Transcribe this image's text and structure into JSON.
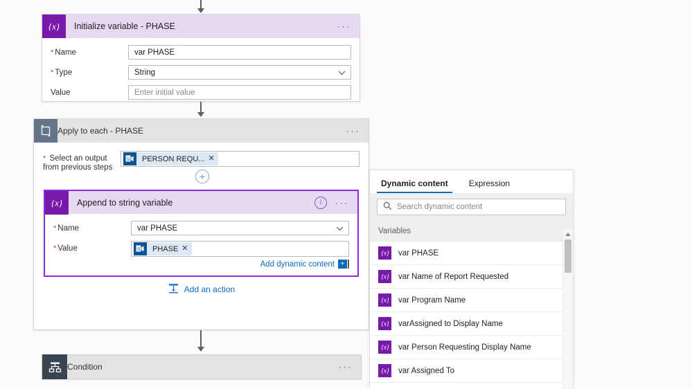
{
  "flow": {
    "initialize_variable": {
      "title": "Initialize variable - PHASE",
      "icon": "variable-icon",
      "fields": [
        {
          "label": "Name",
          "required": true,
          "value": "var PHASE",
          "is_placeholder": false,
          "control": "text"
        },
        {
          "label": "Type",
          "required": true,
          "value": "String",
          "is_placeholder": false,
          "control": "dropdown"
        },
        {
          "label": "Value",
          "required": false,
          "value": "Enter initial value",
          "is_placeholder": true,
          "control": "text"
        }
      ],
      "menu_label": "···"
    },
    "apply_to_each": {
      "title": "Apply to each - PHASE",
      "icon": "loop-icon",
      "field_label_line1": "Select an output",
      "field_label_line2": "from previous steps",
      "field_required": true,
      "token": {
        "text": "PERSON REQU...",
        "icon": "sharepoint-icon",
        "remove": "✕"
      },
      "menu_label": "···",
      "add_between_label": "+"
    },
    "append_to_string": {
      "title": "Append to string variable",
      "icon": "variable-icon",
      "info_label": "i",
      "menu_label": "···",
      "name_label": "Name",
      "name_value": "var PHASE",
      "value_label": "Value",
      "token": {
        "text": "PHASE",
        "icon": "sharepoint-icon",
        "remove": "✕"
      },
      "add_dynamic_content": "Add dynamic content",
      "add_dynamic_content_btn": "+"
    },
    "add_an_action": {
      "label": "Add an action",
      "icon": "add-action-icon"
    },
    "condition": {
      "title": "Condition",
      "icon": "condition-icon",
      "menu_label": "···"
    }
  },
  "dynamic_content_panel": {
    "tabs": [
      {
        "label": "Dynamic content",
        "active": true
      },
      {
        "label": "Expression",
        "active": false
      }
    ],
    "search": {
      "placeholder": "Search dynamic content",
      "icon": "search-icon",
      "value": ""
    },
    "group_header": "Variables",
    "variables": [
      {
        "label": "var PHASE",
        "icon": "variable-icon"
      },
      {
        "label": "var Name of Report Requested",
        "icon": "variable-icon"
      },
      {
        "label": "var Program Name",
        "icon": "variable-icon"
      },
      {
        "label": "varAssigned to Display Name",
        "icon": "variable-icon"
      },
      {
        "label": "var Person Requesting Display Name",
        "icon": "variable-icon"
      },
      {
        "label": "var Assigned To",
        "icon": "variable-icon"
      }
    ]
  },
  "colors": {
    "variable_purple": "#7719aa",
    "variable_header": "#e8d9f2",
    "append_border": "#8a2be2",
    "loop_tile": "#64748b",
    "condition_tile": "#3b4552",
    "grey_header": "#e3e3e3",
    "link_blue": "#0d6bbf",
    "required_red": "#d13438",
    "sharepoint_blue": "#0b5394",
    "chip_fill": "#dce8f5",
    "canvas": "#fbfbfb",
    "page_background": "#f5f5f5"
  }
}
